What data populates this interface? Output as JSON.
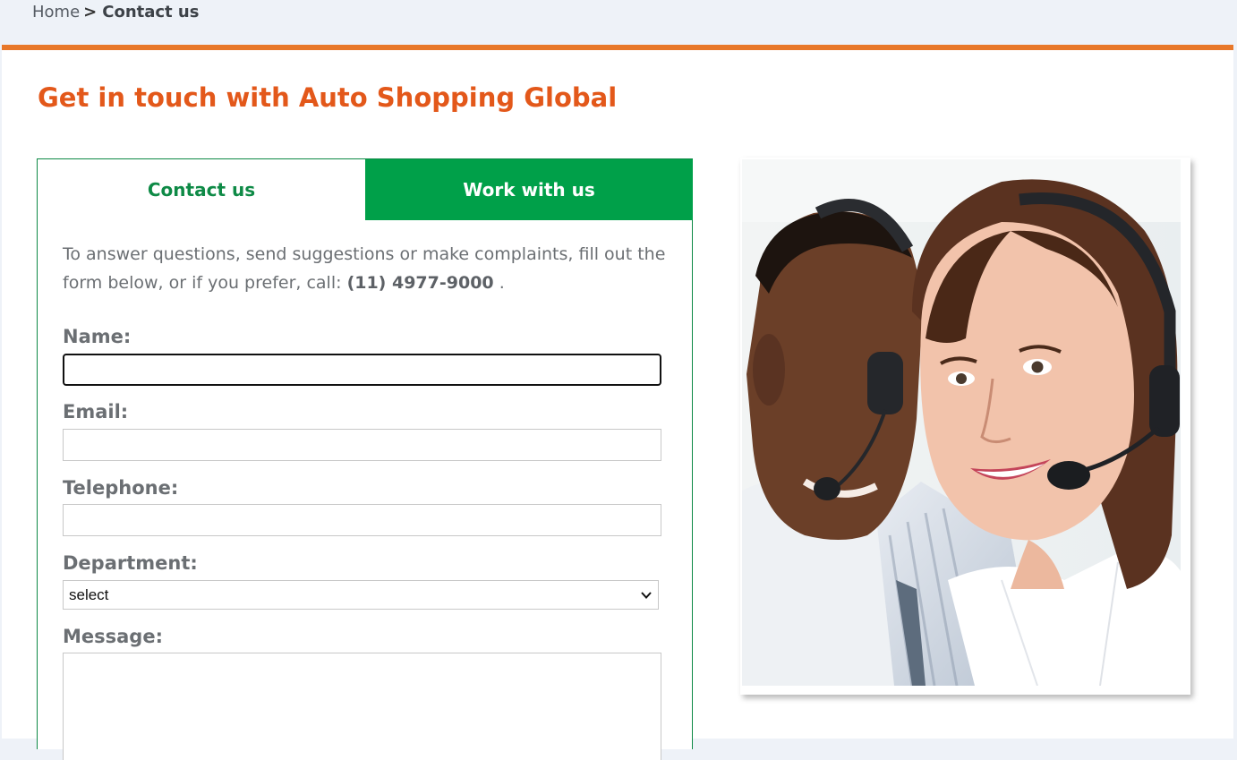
{
  "breadcrumb": {
    "home": "Home",
    "separator": ">",
    "current": "Contact us"
  },
  "page": {
    "title": "Get in touch with Auto Shopping Global"
  },
  "tabs": [
    {
      "label": "Contact us",
      "active": true
    },
    {
      "label": "Work with us",
      "active": false
    }
  ],
  "form": {
    "intro_text": "To answer questions, send suggestions or make complaints, fill out the form below, or if you prefer, call:",
    "phone": "(11) 4977-9000",
    "intro_end": ".",
    "fields": {
      "name_label": "Name:",
      "name_value": "",
      "email_label": "Email:",
      "email_value": "",
      "telephone_label": "Telephone:",
      "telephone_value": "",
      "department_label": "Department:",
      "department_selected": "select",
      "message_label": "Message:",
      "message_value": ""
    }
  },
  "colors": {
    "accent_orange": "#e3581a",
    "border_orange": "#e8782a",
    "brand_green": "#00a049",
    "green_text": "#0e8a46"
  },
  "icons": {
    "dropdown": "chevron-down-icon"
  }
}
